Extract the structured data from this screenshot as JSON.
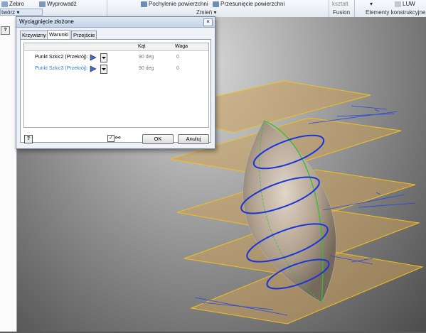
{
  "ribbon": {
    "btn_zebro": "Żebro",
    "btn_wyprowadz": "Wyprowadź",
    "btn_pochylenie": "Pochylenie powierzchni",
    "btn_przesuniecie": "Przesunięcie powierzchni",
    "btn_ksztalt": "kształt",
    "btn_luw": "LUW",
    "group_zmien": "Zmień",
    "group_fusion": "Fusion",
    "group_elementy": "Elementy konstrukcyjne",
    "tab_tworz": "twórz"
  },
  "dialog": {
    "title": "Wyciągnięcie złożone",
    "close": "×",
    "tabs": [
      "Krzywizny",
      "Warunki",
      "Przejście"
    ],
    "active_tab": "Warunki",
    "columns": {
      "kat": "Kąt",
      "waga": "Waga"
    },
    "rows": [
      {
        "name": "Punkt Szkic2 (Przekrój):",
        "kat": "90 deg",
        "waga": "0",
        "highlighted": false
      },
      {
        "name": "Punkt Szkic3 (Przekrój):",
        "kat": "90 deg",
        "waga": "0",
        "highlighted": true
      }
    ],
    "ok": "OK",
    "cancel": "Anuluj",
    "help": "?"
  },
  "left": {
    "help": "?"
  },
  "colors": {
    "highlight_text": "#2f7fd0",
    "plane_fill": "#caa05a",
    "plane_edge": "#f0c020",
    "section_curve": "#1a35d8",
    "rail": "#30c030"
  }
}
